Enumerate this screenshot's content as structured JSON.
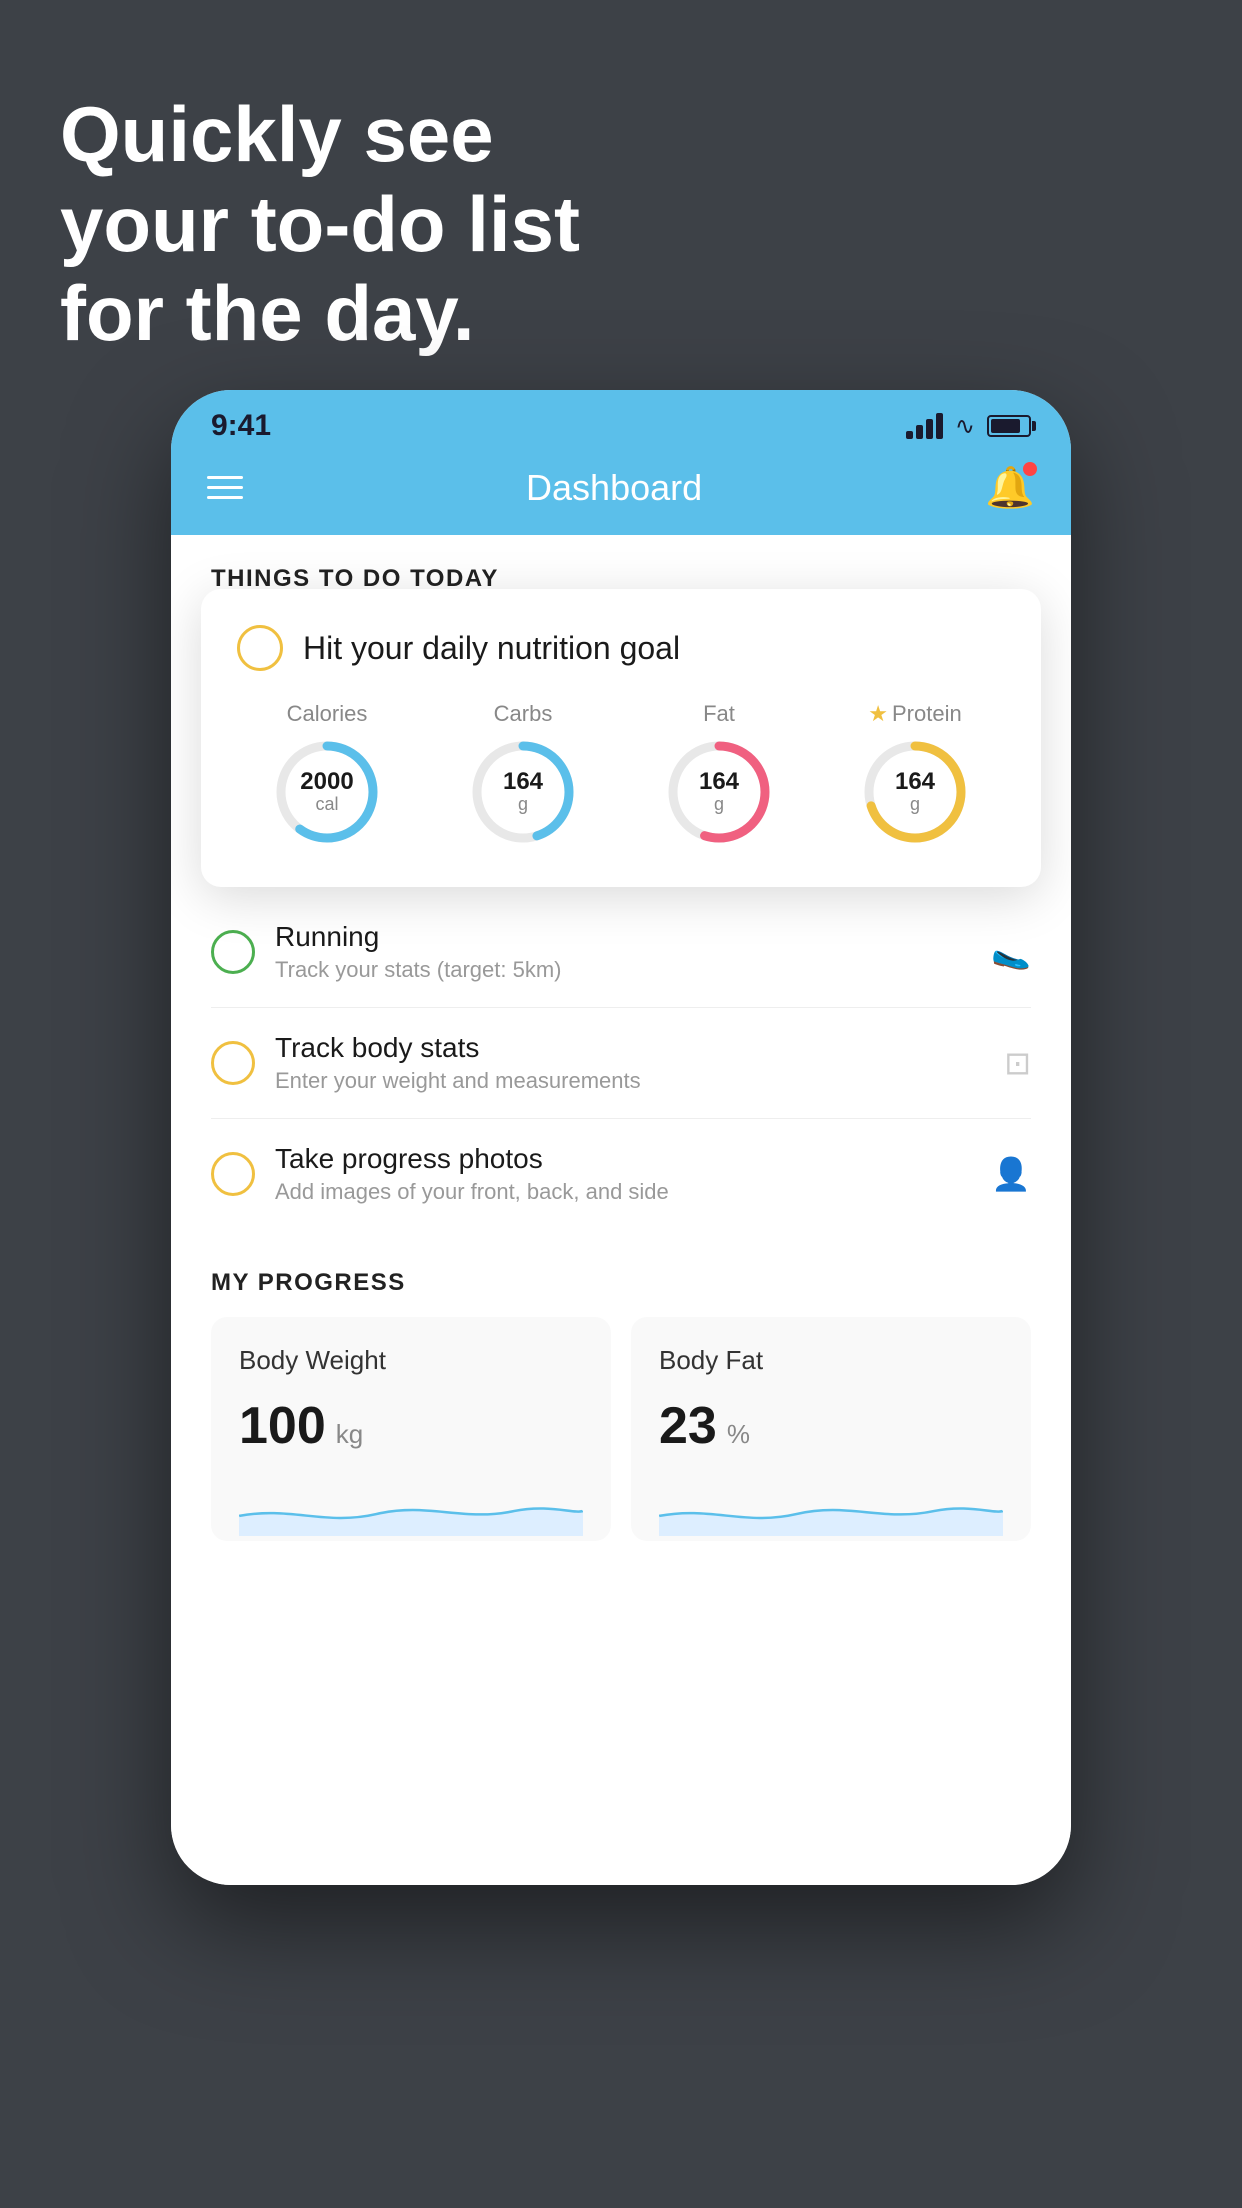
{
  "headline": {
    "line1": "Quickly see",
    "line2": "your to-do list",
    "line3": "for the day."
  },
  "status_bar": {
    "time": "9:41"
  },
  "nav": {
    "title": "Dashboard"
  },
  "things_to_do": {
    "header": "THINGS TO DO TODAY"
  },
  "floating_card": {
    "title": "Hit your daily nutrition goal",
    "nutrition": [
      {
        "label": "Calories",
        "value": "2000",
        "unit": "cal",
        "color": "#5bbfea",
        "percent": 60
      },
      {
        "label": "Carbs",
        "value": "164",
        "unit": "g",
        "color": "#5bbfea",
        "percent": 45
      },
      {
        "label": "Fat",
        "value": "164",
        "unit": "g",
        "color": "#f06080",
        "percent": 55
      },
      {
        "label": "Protein",
        "value": "164",
        "unit": "g",
        "color": "#f0c040",
        "percent": 70,
        "star": true
      }
    ]
  },
  "todo_items": [
    {
      "title": "Running",
      "subtitle": "Track your stats (target: 5km)",
      "circle_color": "green",
      "icon": "🥿"
    },
    {
      "title": "Track body stats",
      "subtitle": "Enter your weight and measurements",
      "circle_color": "yellow",
      "icon": "⊡"
    },
    {
      "title": "Take progress photos",
      "subtitle": "Add images of your front, back, and side",
      "circle_color": "yellow",
      "icon": "👤"
    }
  ],
  "progress": {
    "header": "MY PROGRESS",
    "cards": [
      {
        "title": "Body Weight",
        "value": "100",
        "unit": "kg"
      },
      {
        "title": "Body Fat",
        "value": "23",
        "unit": "%"
      }
    ]
  }
}
